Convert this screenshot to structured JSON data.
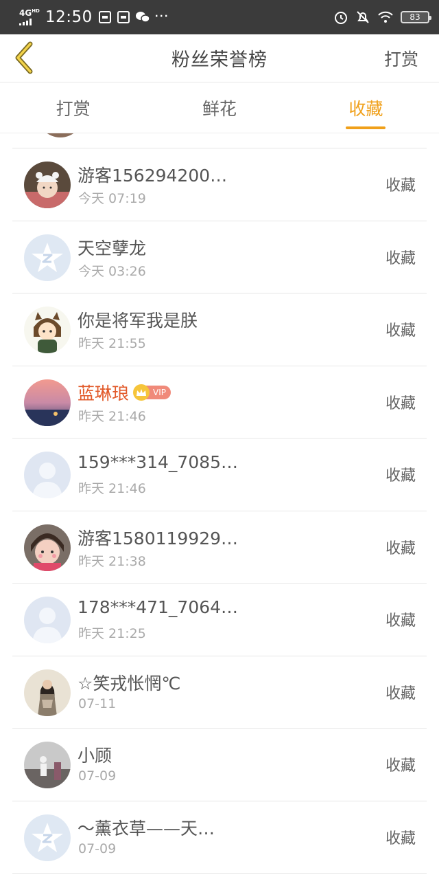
{
  "status_bar": {
    "network": "4G",
    "network_sup": "HD",
    "time": "12:50",
    "battery": "83"
  },
  "header": {
    "back_icon": "chevron-left-icon",
    "title": "粉丝荣誉榜",
    "action_label": "打赏"
  },
  "tabs": [
    {
      "label": "打赏",
      "active": false
    },
    {
      "label": "鲜花",
      "active": false
    },
    {
      "label": "收藏",
      "active": true
    }
  ],
  "colors": {
    "accent": "#f0a01a",
    "vip_name": "#e25a2a",
    "status_bar_bg": "#3b3b3b"
  },
  "list": [
    {
      "name": "游客156294200…",
      "time": "今天 07:19",
      "action": "收藏",
      "avatar": "baby-photo-avatar"
    },
    {
      "name": "天空孽龙",
      "time": "今天 03:26",
      "action": "收藏",
      "avatar": "default-star-avatar"
    },
    {
      "name": "你是将军我是朕",
      "time": "昨天 21:55",
      "action": "收藏",
      "avatar": "cartoon-girl-avatar"
    },
    {
      "name": "蓝琳琅",
      "time": "昨天 21:46",
      "action": "收藏",
      "avatar": "sunset-photo-avatar",
      "vip": true,
      "vip_label": "VIP"
    },
    {
      "name": "159***314_7085…",
      "time": "昨天 21:46",
      "action": "收藏",
      "avatar": "default-person-avatar"
    },
    {
      "name": "游客1580119929…",
      "time": "昨天 21:38",
      "action": "收藏",
      "avatar": "child-photo-avatar"
    },
    {
      "name": "178***471_7064…",
      "time": "昨天 21:25",
      "action": "收藏",
      "avatar": "default-person-avatar"
    },
    {
      "name": "☆笑戎怅惘℃",
      "time": "07-11",
      "action": "收藏",
      "avatar": "woman-photo-avatar"
    },
    {
      "name": "小顾",
      "time": "07-09",
      "action": "收藏",
      "avatar": "figure-photo-avatar"
    },
    {
      "name": "～薰衣草——天…",
      "time": "07-09",
      "action": "收藏",
      "avatar": "default-star-avatar"
    }
  ]
}
